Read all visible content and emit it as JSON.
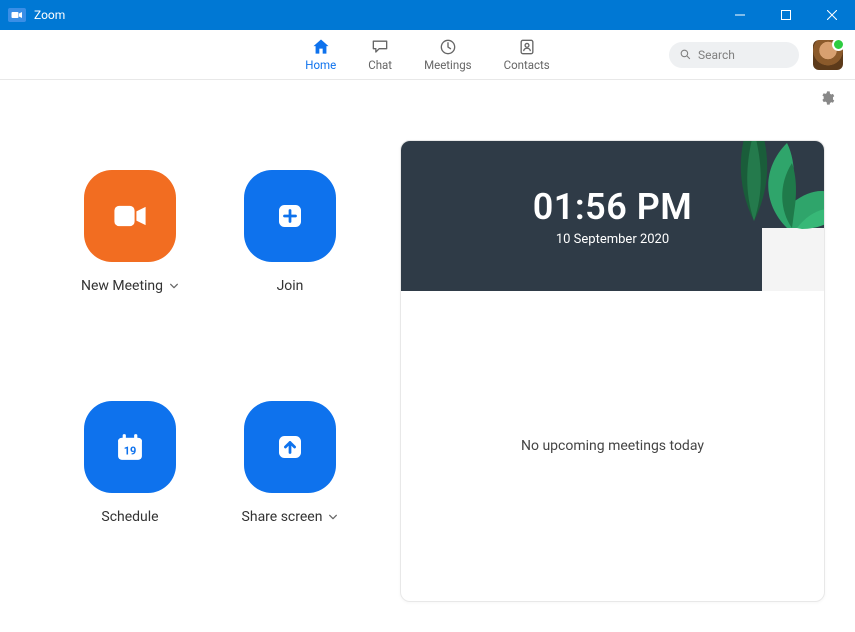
{
  "window": {
    "title": "Zoom"
  },
  "nav": {
    "home": "Home",
    "chat": "Chat",
    "meetings": "Meetings",
    "contacts": "Contacts"
  },
  "search": {
    "placeholder": "Search"
  },
  "actions": {
    "new_meeting": "New Meeting",
    "join": "Join",
    "schedule": "Schedule",
    "schedule_day": "19",
    "share_screen": "Share screen"
  },
  "clock": {
    "time": "01:56 PM",
    "date": "10 September 2020"
  },
  "panel": {
    "empty_text": "No upcoming meetings today"
  }
}
